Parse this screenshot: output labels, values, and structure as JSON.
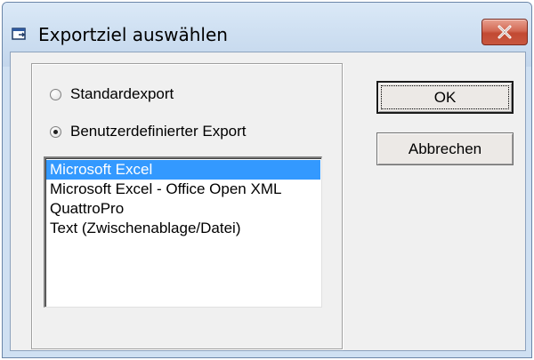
{
  "window": {
    "title": "Exportziel auswählen",
    "close_icon": "close-icon",
    "accent_close": "#c8563f"
  },
  "options": {
    "radios": [
      {
        "label": "Standardexport",
        "checked": false
      },
      {
        "label": "Benutzerdefinierter Export",
        "checked": true
      }
    ],
    "list": {
      "items": [
        {
          "label": "Microsoft Excel",
          "selected": true
        },
        {
          "label": "Microsoft Excel - Office Open XML",
          "selected": false
        },
        {
          "label": "QuattroPro",
          "selected": false
        },
        {
          "label": "Text (Zwischenablage/Datei)",
          "selected": false
        }
      ],
      "selection_color": "#3399ff"
    }
  },
  "buttons": {
    "ok_label": "OK",
    "cancel_label": "Abbrechen"
  }
}
